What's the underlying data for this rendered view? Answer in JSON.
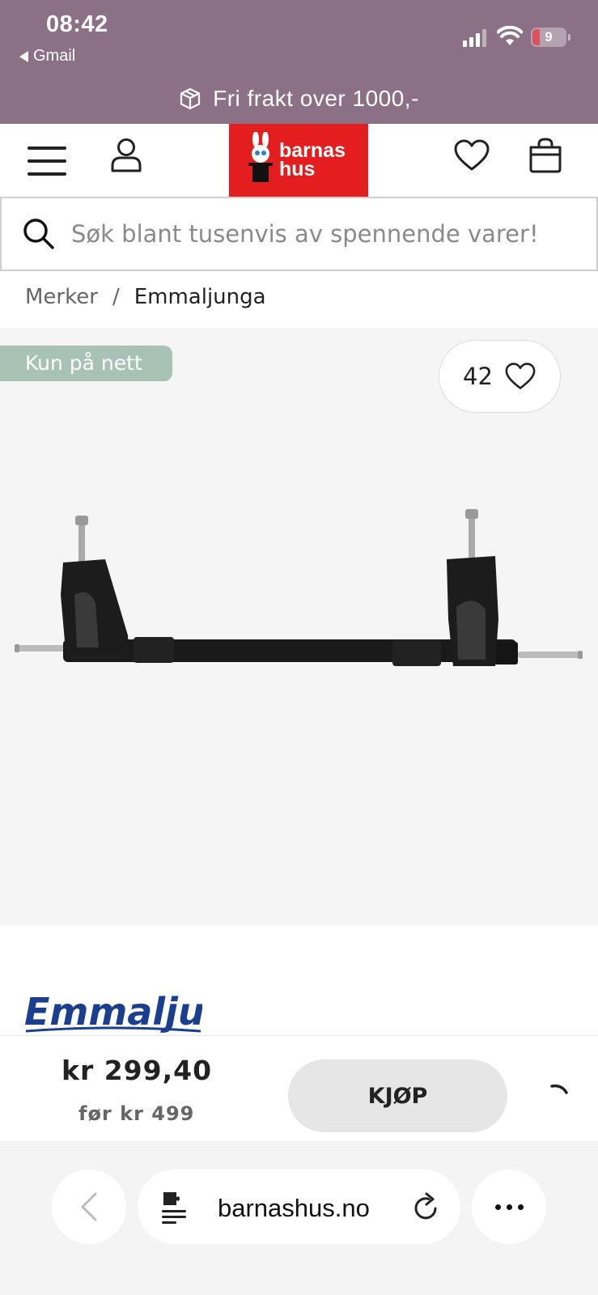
{
  "status_bar": {
    "time": "08:42",
    "back_app": "Gmail",
    "battery": "9"
  },
  "promo": {
    "text": "Fri frakt over 1000,-",
    "icon": "package-icon"
  },
  "header": {
    "logo_line1": "barnas",
    "logo_line2": "hus",
    "icons": [
      "menu-icon",
      "user-icon",
      "heart-icon",
      "shopping-bag-icon"
    ],
    "brand_color": "#e41e1e"
  },
  "search": {
    "placeholder": "Søk blant tusenvis av spennende varer!"
  },
  "breadcrumb": {
    "items": [
      "Merker",
      "Emmaljunga"
    ],
    "separator": "/"
  },
  "product": {
    "badge": "Kun på nett",
    "favorite_count": "42",
    "brand": "Emmaljunga",
    "price": "kr 299,40",
    "old_price": "før kr 499",
    "buy_label": "KJØP"
  },
  "browser": {
    "url": "barnashus.no"
  },
  "colors": {
    "top_band": "#8c7186",
    "badge": "#a8c2b6",
    "brand_blue": "#1b3f8f"
  }
}
